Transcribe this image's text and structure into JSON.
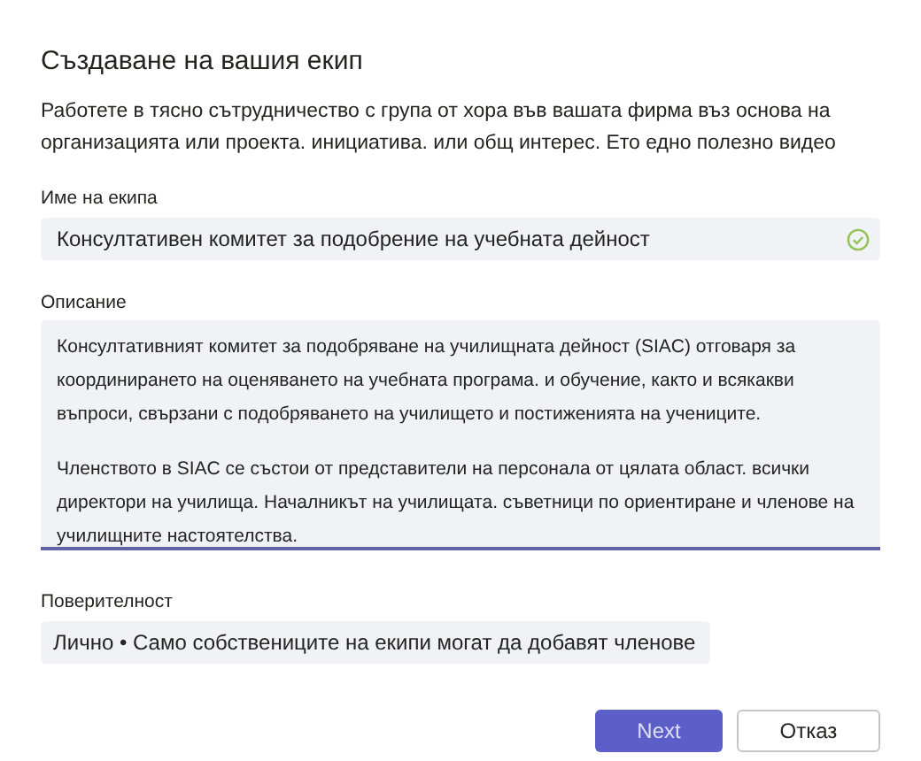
{
  "title": "Създаване на вашия екип",
  "intro": "Работете в тясно сътрудничество с група от хора във вашата фирма въз основа на организацията или проекта. инициатива. или общ интерес. Ето едно полезно видео",
  "team_name": {
    "label": "Име на екипа",
    "value": "Консултативен комитет за подобрение на учебната дейност",
    "valid": true
  },
  "description": {
    "label": "Описание",
    "focused": true,
    "paragraphs": [
      "Консултативният комитет за подобряване на училищната дейност (SIAC) отговаря за координирането на оценяването на учебната програма. и обучение, както и всякакви въпроси, свързани с подобряването на училището и постиженията на учениците.",
      "Членството в SIAC се състои от представители на персонала от цялата област. всички директори на училища. Началникът на училищата. съветници по ориентиране и членове на училищните настоятелства."
    ]
  },
  "privacy": {
    "label": "Поверителност",
    "value": "Лично • Само собствениците на екипи могат да добавят членове"
  },
  "buttons": [
    {
      "label": "Next",
      "kind": "primary"
    },
    {
      "label": "Отказ",
      "kind": "secondary"
    }
  ]
}
